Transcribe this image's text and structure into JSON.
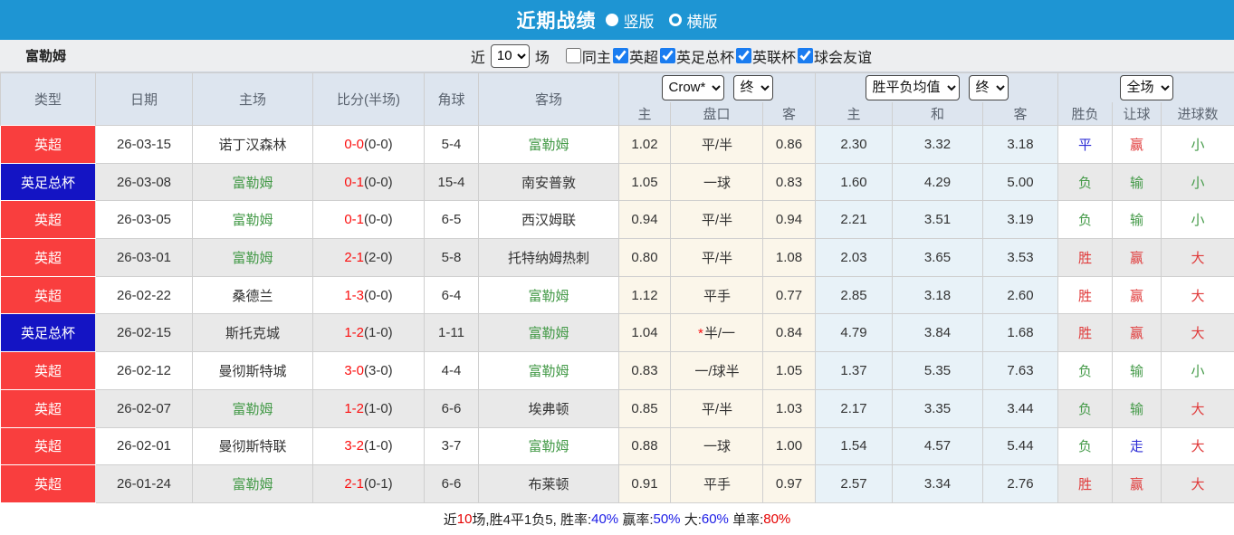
{
  "title_bar": {
    "title": "近期战绩",
    "layout_options": [
      {
        "label": "竖版",
        "selected": true
      },
      {
        "label": "横版",
        "selected": false
      }
    ]
  },
  "filter_bar": {
    "team_name": "富勒姆",
    "recent_label": "近",
    "recent_count": "10",
    "matches_label": "场",
    "filters": [
      {
        "label": "同主",
        "checked": false
      },
      {
        "label": "英超",
        "checked": true
      },
      {
        "label": "英足总杯",
        "checked": true
      },
      {
        "label": "英联杯",
        "checked": true
      },
      {
        "label": "球会友谊",
        "checked": true
      }
    ]
  },
  "table": {
    "columns": [
      "类型",
      "日期",
      "主场",
      "比分(半场)",
      "角球",
      "客场"
    ],
    "asian_company_select": "Crow*",
    "asian_time_select": "终",
    "europe_company_select": "胜平负均值",
    "europe_time_select": "终",
    "period_select": "全场",
    "sub_columns": {
      "asian": [
        "主",
        "盘口",
        "客"
      ],
      "europe": [
        "主",
        "和",
        "客"
      ],
      "result": [
        "胜负",
        "让球",
        "进球数"
      ]
    },
    "rows": [
      {
        "type": "英超",
        "type_color": "red",
        "date": "26-03-15",
        "home": "诺丁汉森林",
        "home_highlight": false,
        "score": "0-0",
        "half": "(0-0)",
        "corners": "5-4",
        "away": "富勒姆",
        "away_highlight": true,
        "asian_home": "1.02",
        "handicap": "平/半",
        "handicap_star": false,
        "asian_away": "0.86",
        "euro_home": "2.30",
        "euro_draw": "3.32",
        "euro_away": "3.18",
        "results": [
          {
            "text": "平",
            "color": "blue"
          },
          {
            "text": "赢",
            "color": "red"
          },
          {
            "text": "小",
            "color": "green"
          }
        ]
      },
      {
        "type": "英足总杯",
        "type_color": "blue",
        "date": "26-03-08",
        "home": "富勒姆",
        "home_highlight": true,
        "score": "0-1",
        "half": "(0-0)",
        "corners": "15-4",
        "away": "南安普敦",
        "away_highlight": false,
        "asian_home": "1.05",
        "handicap": "一球",
        "handicap_star": false,
        "asian_away": "0.83",
        "euro_home": "1.60",
        "euro_draw": "4.29",
        "euro_away": "5.00",
        "results": [
          {
            "text": "负",
            "color": "green"
          },
          {
            "text": "输",
            "color": "green"
          },
          {
            "text": "小",
            "color": "green"
          }
        ]
      },
      {
        "type": "英超",
        "type_color": "red",
        "date": "26-03-05",
        "home": "富勒姆",
        "home_highlight": true,
        "score": "0-1",
        "half": "(0-0)",
        "corners": "6-5",
        "away": "西汉姆联",
        "away_highlight": false,
        "asian_home": "0.94",
        "handicap": "平/半",
        "handicap_star": false,
        "asian_away": "0.94",
        "euro_home": "2.21",
        "euro_draw": "3.51",
        "euro_away": "3.19",
        "results": [
          {
            "text": "负",
            "color": "green"
          },
          {
            "text": "输",
            "color": "green"
          },
          {
            "text": "小",
            "color": "green"
          }
        ]
      },
      {
        "type": "英超",
        "type_color": "red",
        "date": "26-03-01",
        "home": "富勒姆",
        "home_highlight": true,
        "score": "2-1",
        "half": "(2-0)",
        "corners": "5-8",
        "away": "托特纳姆热刺",
        "away_highlight": false,
        "asian_home": "0.80",
        "handicap": "平/半",
        "handicap_star": false,
        "asian_away": "1.08",
        "euro_home": "2.03",
        "euro_draw": "3.65",
        "euro_away": "3.53",
        "results": [
          {
            "text": "胜",
            "color": "red"
          },
          {
            "text": "赢",
            "color": "red"
          },
          {
            "text": "大",
            "color": "red"
          }
        ]
      },
      {
        "type": "英超",
        "type_color": "red",
        "date": "26-02-22",
        "home": "桑德兰",
        "home_highlight": false,
        "score": "1-3",
        "half": "(0-0)",
        "corners": "6-4",
        "away": "富勒姆",
        "away_highlight": true,
        "asian_home": "1.12",
        "handicap": "平手",
        "handicap_star": false,
        "asian_away": "0.77",
        "euro_home": "2.85",
        "euro_draw": "3.18",
        "euro_away": "2.60",
        "results": [
          {
            "text": "胜",
            "color": "red"
          },
          {
            "text": "赢",
            "color": "red"
          },
          {
            "text": "大",
            "color": "red"
          }
        ]
      },
      {
        "type": "英足总杯",
        "type_color": "blue",
        "date": "26-02-15",
        "home": "斯托克城",
        "home_highlight": false,
        "score": "1-2",
        "half": "(1-0)",
        "corners": "1-11",
        "away": "富勒姆",
        "away_highlight": true,
        "asian_home": "1.04",
        "handicap": "半/一",
        "handicap_star": true,
        "asian_away": "0.84",
        "euro_home": "4.79",
        "euro_draw": "3.84",
        "euro_away": "1.68",
        "results": [
          {
            "text": "胜",
            "color": "red"
          },
          {
            "text": "赢",
            "color": "red"
          },
          {
            "text": "大",
            "color": "red"
          }
        ]
      },
      {
        "type": "英超",
        "type_color": "red",
        "date": "26-02-12",
        "home": "曼彻斯特城",
        "home_highlight": false,
        "score": "3-0",
        "half": "(3-0)",
        "corners": "4-4",
        "away": "富勒姆",
        "away_highlight": true,
        "asian_home": "0.83",
        "handicap": "一/球半",
        "handicap_star": false,
        "asian_away": "1.05",
        "euro_home": "1.37",
        "euro_draw": "5.35",
        "euro_away": "7.63",
        "results": [
          {
            "text": "负",
            "color": "green"
          },
          {
            "text": "输",
            "color": "green"
          },
          {
            "text": "小",
            "color": "green"
          }
        ]
      },
      {
        "type": "英超",
        "type_color": "red",
        "date": "26-02-07",
        "home": "富勒姆",
        "home_highlight": true,
        "score": "1-2",
        "half": "(1-0)",
        "corners": "6-6",
        "away": "埃弗顿",
        "away_highlight": false,
        "asian_home": "0.85",
        "handicap": "平/半",
        "handicap_star": false,
        "asian_away": "1.03",
        "euro_home": "2.17",
        "euro_draw": "3.35",
        "euro_away": "3.44",
        "results": [
          {
            "text": "负",
            "color": "green"
          },
          {
            "text": "输",
            "color": "green"
          },
          {
            "text": "大",
            "color": "red"
          }
        ]
      },
      {
        "type": "英超",
        "type_color": "red",
        "date": "26-02-01",
        "home": "曼彻斯特联",
        "home_highlight": false,
        "score": "3-2",
        "half": "(1-0)",
        "corners": "3-7",
        "away": "富勒姆",
        "away_highlight": true,
        "asian_home": "0.88",
        "handicap": "一球",
        "handicap_star": false,
        "asian_away": "1.00",
        "euro_home": "1.54",
        "euro_draw": "4.57",
        "euro_away": "5.44",
        "results": [
          {
            "text": "负",
            "color": "green"
          },
          {
            "text": "走",
            "color": "blue"
          },
          {
            "text": "大",
            "color": "red"
          }
        ]
      },
      {
        "type": "英超",
        "type_color": "red",
        "date": "26-01-24",
        "home": "富勒姆",
        "home_highlight": true,
        "score": "2-1",
        "half": "(0-1)",
        "corners": "6-6",
        "away": "布莱顿",
        "away_highlight": false,
        "asian_home": "0.91",
        "handicap": "平手",
        "handicap_star": false,
        "asian_away": "0.97",
        "euro_home": "2.57",
        "euro_draw": "3.34",
        "euro_away": "2.76",
        "results": [
          {
            "text": "胜",
            "color": "red"
          },
          {
            "text": "赢",
            "color": "red"
          },
          {
            "text": "大",
            "color": "red"
          }
        ]
      }
    ]
  },
  "summary": {
    "segments": [
      {
        "text": "近",
        "color": "black"
      },
      {
        "text": "10",
        "color": "red"
      },
      {
        "text": "场,胜4平1负5, 胜率:",
        "color": "black"
      },
      {
        "text": "40%",
        "color": "blue"
      },
      {
        "text": " 赢率:",
        "color": "black"
      },
      {
        "text": "50%",
        "color": "blue"
      },
      {
        "text": " 大:",
        "color": "black"
      },
      {
        "text": "60%",
        "color": "blue"
      },
      {
        "text": " 单率:",
        "color": "black"
      },
      {
        "text": "80%",
        "color": "red"
      }
    ]
  },
  "colors": {
    "accent_blue": "#1e95d3",
    "league_red": "#f93e3e",
    "cup_blue": "#1414c4",
    "team_green": "#449a48",
    "score_red": "#fb0e0e",
    "win_red": "#e03a3a",
    "draw_blue": "#2b2bd5",
    "lose_green": "#449a48"
  }
}
